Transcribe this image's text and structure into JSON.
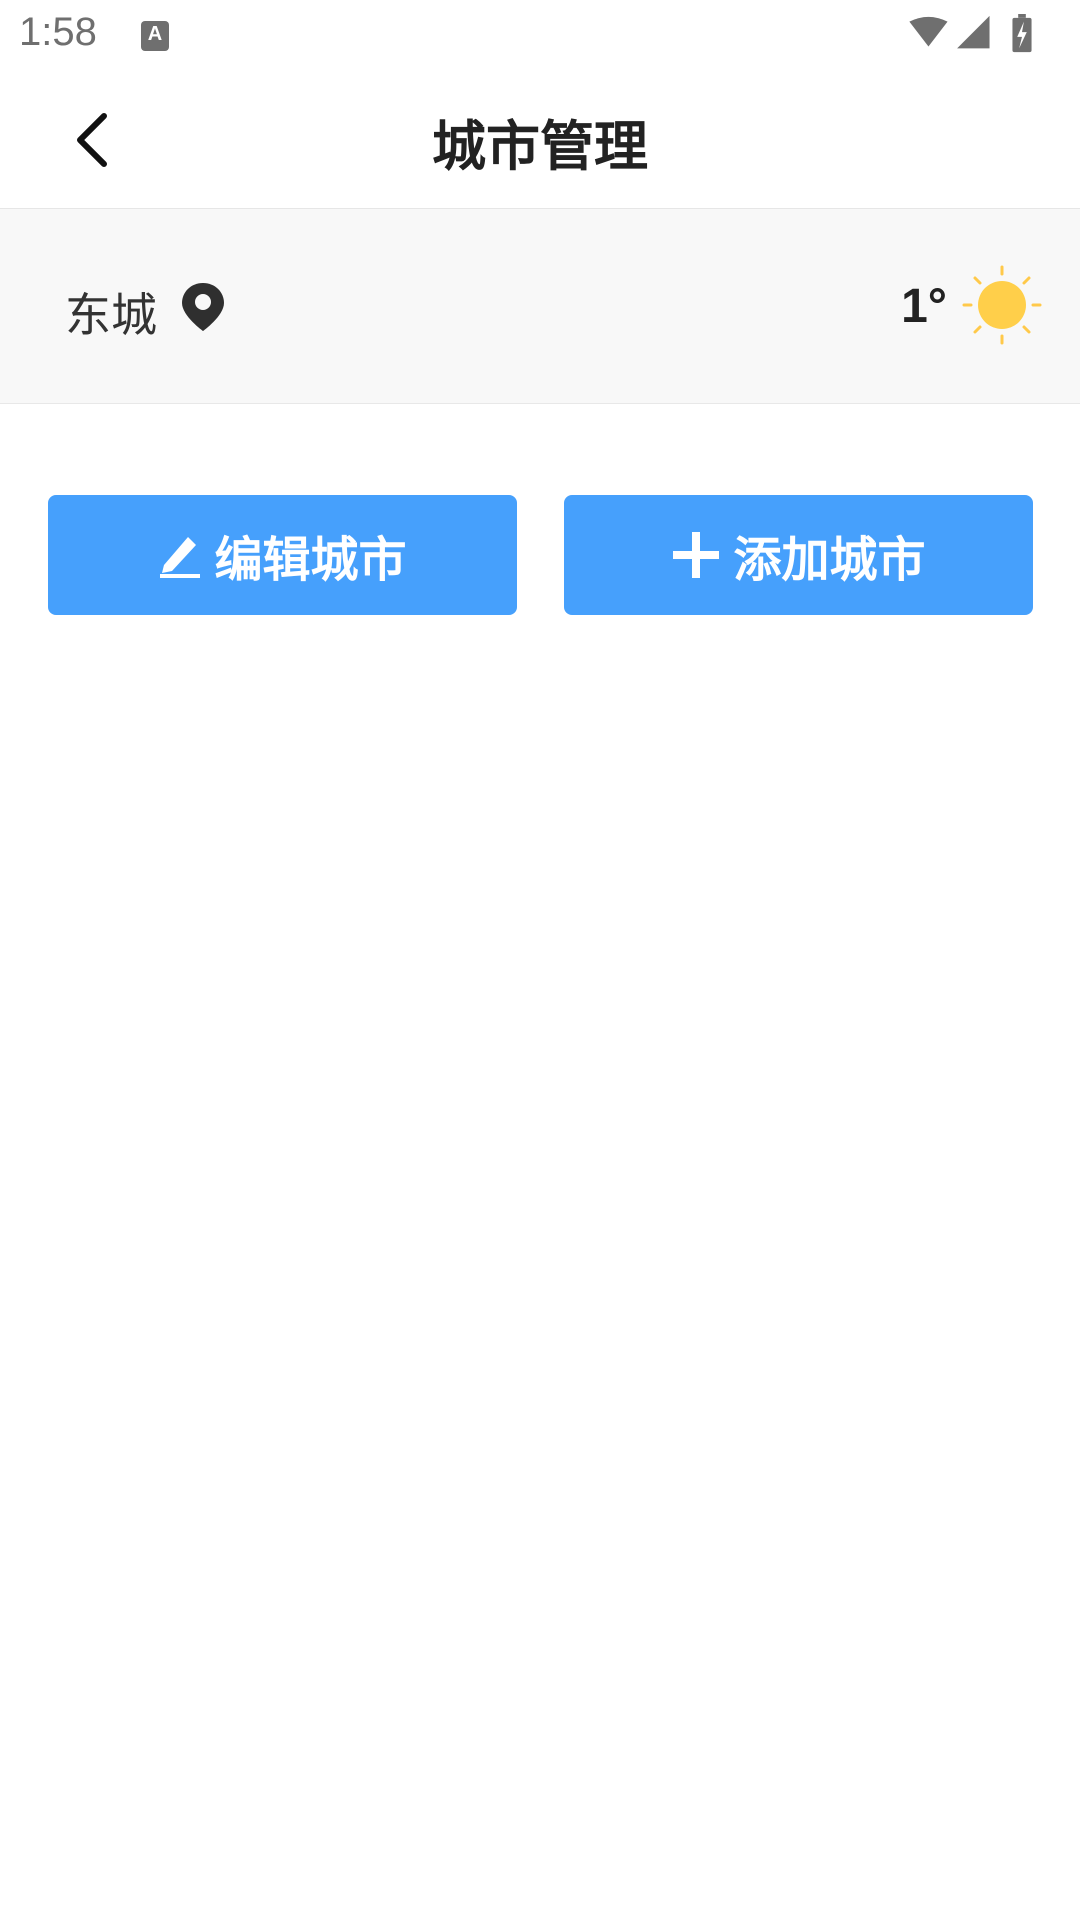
{
  "status_bar": {
    "time": "1:58",
    "notification_icon_letter": "A",
    "icons": [
      "wifi-icon",
      "signal-icon",
      "battery-charging-icon"
    ]
  },
  "header": {
    "title": "城市管理",
    "back_icon": "chevron-left-icon"
  },
  "city": {
    "name": "东城",
    "location_icon": "location-pin-icon",
    "temperature": "1°",
    "weather_icon": "sun-icon"
  },
  "actions": {
    "edit_label": "编辑城市",
    "edit_icon": "pencil-icon",
    "add_label": "添加城市",
    "add_icon": "plus-icon"
  },
  "colors": {
    "accent": "#46a0fc",
    "sun": "#ffcf4a"
  }
}
